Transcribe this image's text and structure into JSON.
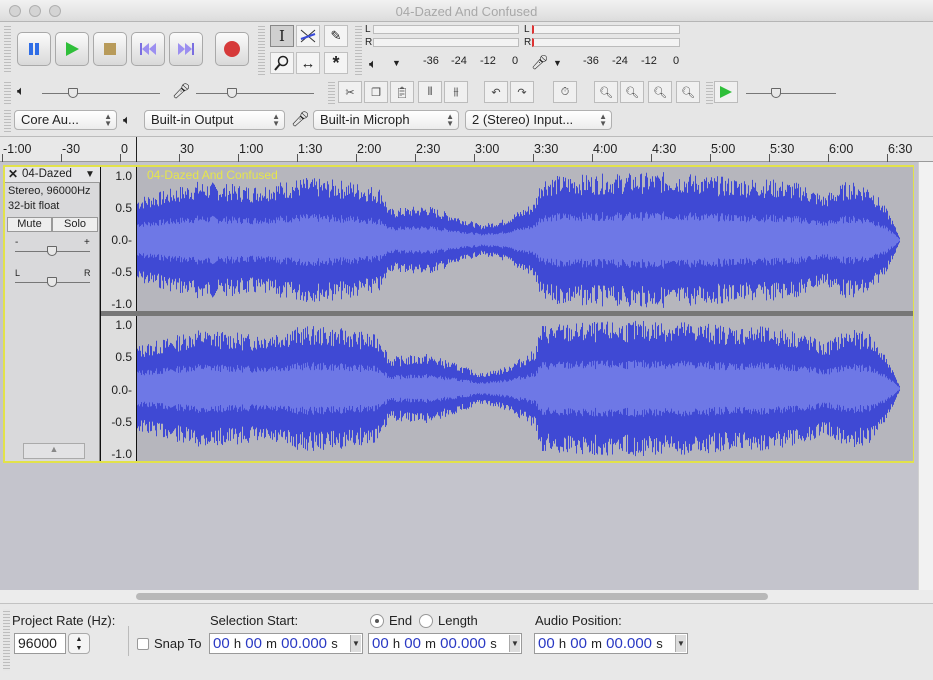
{
  "window": {
    "title": "04-Dazed And Confused"
  },
  "transport": {
    "pause": "pause-icon",
    "play": "play-icon",
    "stop": "stop-icon",
    "skip_start": "skip-start-icon",
    "skip_end": "skip-end-icon",
    "record": "record-icon"
  },
  "meters": {
    "playback": {
      "l": "L",
      "r": "R",
      "scale": [
        "-36",
        "-24",
        "-12",
        "0"
      ]
    },
    "record": {
      "l": "L",
      "r": "R",
      "scale": [
        "-36",
        "-24",
        "-12",
        "0"
      ]
    }
  },
  "device": {
    "host": "Core Au...",
    "output": "Built-in Output",
    "input": "Built-in Microph",
    "channels": "2 (Stereo) Input..."
  },
  "ruler": {
    "ticks": [
      "-1:00",
      "-30",
      "0",
      "30",
      "1:00",
      "1:30",
      "2:00",
      "2:30",
      "3:00",
      "3:30",
      "4:00",
      "4:30",
      "5:00",
      "5:30",
      "6:00",
      "6:30"
    ]
  },
  "track": {
    "name": "04-Dazed",
    "label": "04-Dazed And Confused",
    "info_format": "Stereo, 96000Hz",
    "info_bits": "32-bit float",
    "mute": "Mute",
    "solo": "Solo",
    "gain_minus": "-",
    "gain_plus": "+",
    "pan_left": "L",
    "pan_right": "R",
    "vruler": [
      "1.0",
      "0.5",
      "0.0-",
      "-0.5",
      "-1.0"
    ]
  },
  "selection": {
    "project_rate_label": "Project Rate (Hz):",
    "project_rate": "96000",
    "snap_to": "Snap To",
    "selection_start_label": "Selection Start:",
    "end": "End",
    "length": "Length",
    "audio_position_label": "Audio Position:",
    "time_h": "00",
    "time_h_unit": "h",
    "time_m": "00",
    "time_m_unit": "m",
    "time_s": "00.000",
    "time_s_unit": "s"
  },
  "colors": {
    "wave": "#3f49d4",
    "wave_rms": "#6e78e6",
    "track_border": "#e2e24a",
    "track_label": "#e6e64a"
  }
}
